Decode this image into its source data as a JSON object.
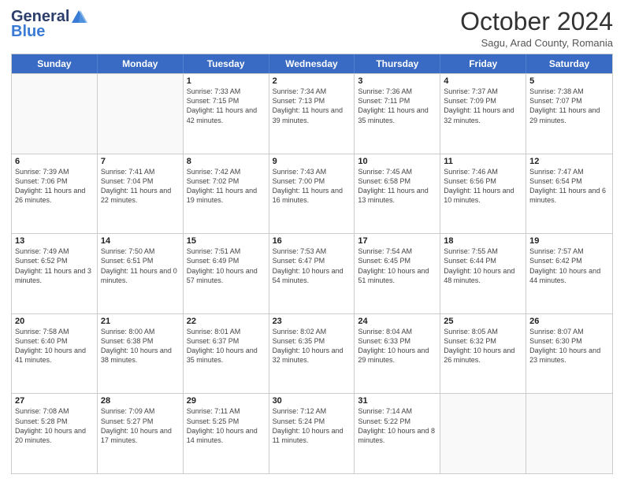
{
  "header": {
    "logo_general": "General",
    "logo_blue": "Blue",
    "month_title": "October 2024",
    "location": "Sagu, Arad County, Romania"
  },
  "days_of_week": [
    "Sunday",
    "Monday",
    "Tuesday",
    "Wednesday",
    "Thursday",
    "Friday",
    "Saturday"
  ],
  "weeks": [
    [
      {
        "day": "",
        "sunrise": "",
        "sunset": "",
        "daylight": ""
      },
      {
        "day": "",
        "sunrise": "",
        "sunset": "",
        "daylight": ""
      },
      {
        "day": "1",
        "sunrise": "Sunrise: 7:33 AM",
        "sunset": "Sunset: 7:15 PM",
        "daylight": "Daylight: 11 hours and 42 minutes."
      },
      {
        "day": "2",
        "sunrise": "Sunrise: 7:34 AM",
        "sunset": "Sunset: 7:13 PM",
        "daylight": "Daylight: 11 hours and 39 minutes."
      },
      {
        "day": "3",
        "sunrise": "Sunrise: 7:36 AM",
        "sunset": "Sunset: 7:11 PM",
        "daylight": "Daylight: 11 hours and 35 minutes."
      },
      {
        "day": "4",
        "sunrise": "Sunrise: 7:37 AM",
        "sunset": "Sunset: 7:09 PM",
        "daylight": "Daylight: 11 hours and 32 minutes."
      },
      {
        "day": "5",
        "sunrise": "Sunrise: 7:38 AM",
        "sunset": "Sunset: 7:07 PM",
        "daylight": "Daylight: 11 hours and 29 minutes."
      }
    ],
    [
      {
        "day": "6",
        "sunrise": "Sunrise: 7:39 AM",
        "sunset": "Sunset: 7:06 PM",
        "daylight": "Daylight: 11 hours and 26 minutes."
      },
      {
        "day": "7",
        "sunrise": "Sunrise: 7:41 AM",
        "sunset": "Sunset: 7:04 PM",
        "daylight": "Daylight: 11 hours and 22 minutes."
      },
      {
        "day": "8",
        "sunrise": "Sunrise: 7:42 AM",
        "sunset": "Sunset: 7:02 PM",
        "daylight": "Daylight: 11 hours and 19 minutes."
      },
      {
        "day": "9",
        "sunrise": "Sunrise: 7:43 AM",
        "sunset": "Sunset: 7:00 PM",
        "daylight": "Daylight: 11 hours and 16 minutes."
      },
      {
        "day": "10",
        "sunrise": "Sunrise: 7:45 AM",
        "sunset": "Sunset: 6:58 PM",
        "daylight": "Daylight: 11 hours and 13 minutes."
      },
      {
        "day": "11",
        "sunrise": "Sunrise: 7:46 AM",
        "sunset": "Sunset: 6:56 PM",
        "daylight": "Daylight: 11 hours and 10 minutes."
      },
      {
        "day": "12",
        "sunrise": "Sunrise: 7:47 AM",
        "sunset": "Sunset: 6:54 PM",
        "daylight": "Daylight: 11 hours and 6 minutes."
      }
    ],
    [
      {
        "day": "13",
        "sunrise": "Sunrise: 7:49 AM",
        "sunset": "Sunset: 6:52 PM",
        "daylight": "Daylight: 11 hours and 3 minutes."
      },
      {
        "day": "14",
        "sunrise": "Sunrise: 7:50 AM",
        "sunset": "Sunset: 6:51 PM",
        "daylight": "Daylight: 11 hours and 0 minutes."
      },
      {
        "day": "15",
        "sunrise": "Sunrise: 7:51 AM",
        "sunset": "Sunset: 6:49 PM",
        "daylight": "Daylight: 10 hours and 57 minutes."
      },
      {
        "day": "16",
        "sunrise": "Sunrise: 7:53 AM",
        "sunset": "Sunset: 6:47 PM",
        "daylight": "Daylight: 10 hours and 54 minutes."
      },
      {
        "day": "17",
        "sunrise": "Sunrise: 7:54 AM",
        "sunset": "Sunset: 6:45 PM",
        "daylight": "Daylight: 10 hours and 51 minutes."
      },
      {
        "day": "18",
        "sunrise": "Sunrise: 7:55 AM",
        "sunset": "Sunset: 6:44 PM",
        "daylight": "Daylight: 10 hours and 48 minutes."
      },
      {
        "day": "19",
        "sunrise": "Sunrise: 7:57 AM",
        "sunset": "Sunset: 6:42 PM",
        "daylight": "Daylight: 10 hours and 44 minutes."
      }
    ],
    [
      {
        "day": "20",
        "sunrise": "Sunrise: 7:58 AM",
        "sunset": "Sunset: 6:40 PM",
        "daylight": "Daylight: 10 hours and 41 minutes."
      },
      {
        "day": "21",
        "sunrise": "Sunrise: 8:00 AM",
        "sunset": "Sunset: 6:38 PM",
        "daylight": "Daylight: 10 hours and 38 minutes."
      },
      {
        "day": "22",
        "sunrise": "Sunrise: 8:01 AM",
        "sunset": "Sunset: 6:37 PM",
        "daylight": "Daylight: 10 hours and 35 minutes."
      },
      {
        "day": "23",
        "sunrise": "Sunrise: 8:02 AM",
        "sunset": "Sunset: 6:35 PM",
        "daylight": "Daylight: 10 hours and 32 minutes."
      },
      {
        "day": "24",
        "sunrise": "Sunrise: 8:04 AM",
        "sunset": "Sunset: 6:33 PM",
        "daylight": "Daylight: 10 hours and 29 minutes."
      },
      {
        "day": "25",
        "sunrise": "Sunrise: 8:05 AM",
        "sunset": "Sunset: 6:32 PM",
        "daylight": "Daylight: 10 hours and 26 minutes."
      },
      {
        "day": "26",
        "sunrise": "Sunrise: 8:07 AM",
        "sunset": "Sunset: 6:30 PM",
        "daylight": "Daylight: 10 hours and 23 minutes."
      }
    ],
    [
      {
        "day": "27",
        "sunrise": "Sunrise: 7:08 AM",
        "sunset": "Sunset: 5:28 PM",
        "daylight": "Daylight: 10 hours and 20 minutes."
      },
      {
        "day": "28",
        "sunrise": "Sunrise: 7:09 AM",
        "sunset": "Sunset: 5:27 PM",
        "daylight": "Daylight: 10 hours and 17 minutes."
      },
      {
        "day": "29",
        "sunrise": "Sunrise: 7:11 AM",
        "sunset": "Sunset: 5:25 PM",
        "daylight": "Daylight: 10 hours and 14 minutes."
      },
      {
        "day": "30",
        "sunrise": "Sunrise: 7:12 AM",
        "sunset": "Sunset: 5:24 PM",
        "daylight": "Daylight: 10 hours and 11 minutes."
      },
      {
        "day": "31",
        "sunrise": "Sunrise: 7:14 AM",
        "sunset": "Sunset: 5:22 PM",
        "daylight": "Daylight: 10 hours and 8 minutes."
      },
      {
        "day": "",
        "sunrise": "",
        "sunset": "",
        "daylight": ""
      },
      {
        "day": "",
        "sunrise": "",
        "sunset": "",
        "daylight": ""
      }
    ]
  ]
}
